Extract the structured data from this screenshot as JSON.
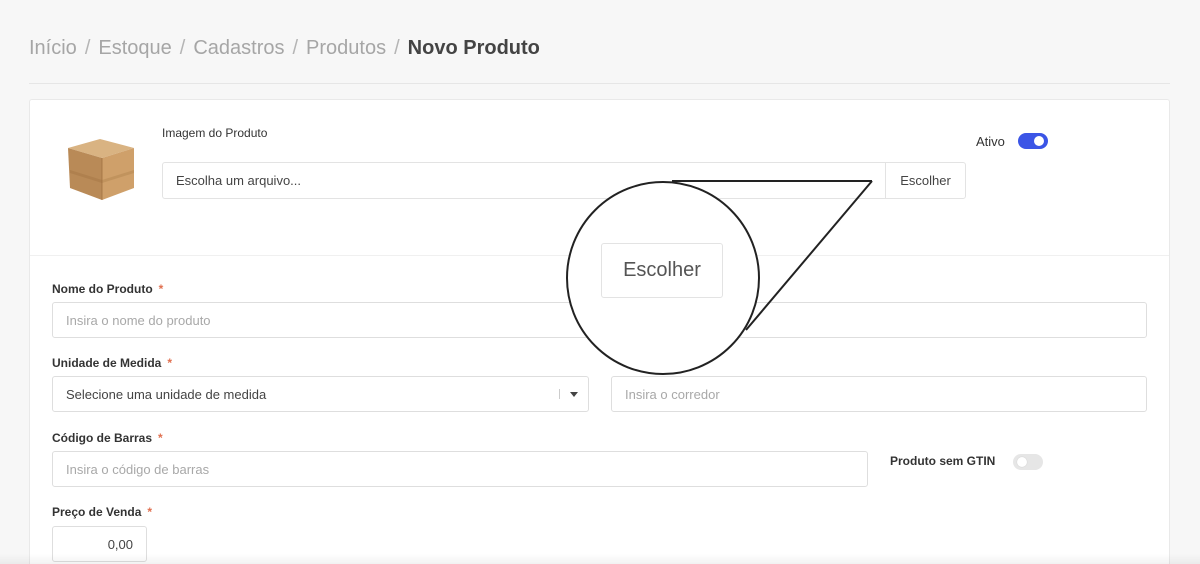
{
  "breadcrumb": {
    "items": [
      "Início",
      "Estoque",
      "Cadastros",
      "Produtos"
    ],
    "current": "Novo Produto",
    "separator": "/"
  },
  "image_section": {
    "label": "Imagem do Produto",
    "file_placeholder": "Escolha um arquivo...",
    "choose_button": "Escolher",
    "product_icon": "cardboard-box-icon"
  },
  "active_toggle": {
    "label": "Ativo",
    "checked": true
  },
  "fields": {
    "name": {
      "label": "Nome do Produto",
      "required_mark": "*",
      "placeholder": "Insira o nome do produto"
    },
    "unit": {
      "label": "Unidade de Medida",
      "required_mark": "*",
      "selected": "Selecione uma unidade de medida"
    },
    "corridor": {
      "placeholder": "Insira o corredor"
    },
    "barcode": {
      "label": "Código de Barras",
      "required_mark": "*",
      "placeholder": "Insira o código de barras"
    },
    "no_gtin": {
      "label": "Produto sem GTIN",
      "checked": false
    },
    "price": {
      "label": "Preço de Venda",
      "required_mark": "*",
      "value": "0,00"
    }
  },
  "magnifier": {
    "zoomed_button_label": "Escolher"
  },
  "colors": {
    "accent": "#3b55e6",
    "required": "#e07050",
    "background": "#f7f7f7"
  }
}
